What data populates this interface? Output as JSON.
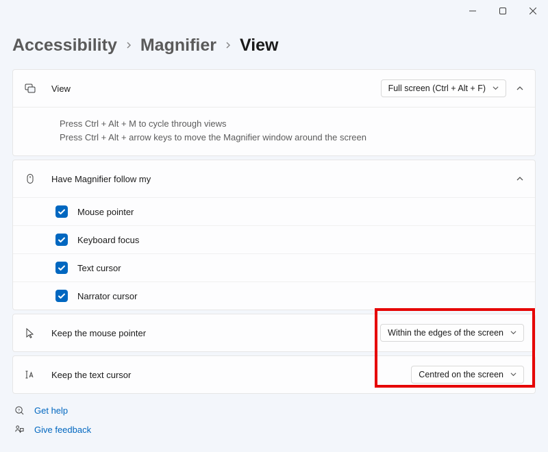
{
  "window": {},
  "breadcrumb": {
    "accessibility": "Accessibility",
    "magnifier": "Magnifier",
    "view": "View"
  },
  "view_section": {
    "label": "View",
    "dropdown": "Full screen (Ctrl + Alt + F)",
    "hint_line1": "Press Ctrl + Alt + M to cycle through views",
    "hint_line2": "Press Ctrl + Alt + arrow keys to move the Magnifier window around the screen"
  },
  "follow_section": {
    "label": "Have Magnifier follow my",
    "items": [
      {
        "label": "Mouse pointer",
        "checked": true
      },
      {
        "label": "Keyboard focus",
        "checked": true
      },
      {
        "label": "Text cursor",
        "checked": true
      },
      {
        "label": "Narrator cursor",
        "checked": true
      }
    ]
  },
  "mouse_section": {
    "label": "Keep the mouse pointer",
    "dropdown": "Within the edges of the screen"
  },
  "text_section": {
    "label": "Keep the text cursor",
    "dropdown": "Centred on the screen"
  },
  "links": {
    "help": "Get help",
    "feedback": "Give feedback"
  }
}
